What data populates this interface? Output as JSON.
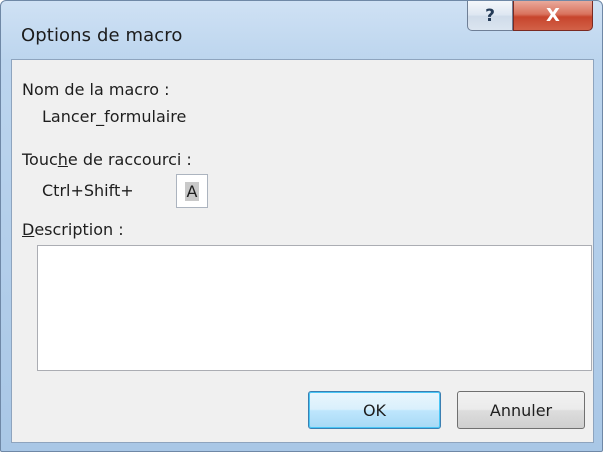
{
  "window": {
    "title": "Options de macro",
    "help_glyph": "?",
    "close_glyph": "X"
  },
  "macro": {
    "name_label": "Nom de la macro :",
    "name_value": "Lancer_formulaire"
  },
  "shortcut": {
    "label_before": "Touc",
    "label_mnemonic": "h",
    "label_after": "e de raccourci :",
    "prefix": "Ctrl+Shift+",
    "key_value": "A"
  },
  "description": {
    "label_mnemonic": "D",
    "label_rest": "escription :",
    "value": ""
  },
  "buttons": {
    "ok": "OK",
    "cancel": "Annuler"
  },
  "colors": {
    "frame": "#bcd5ee",
    "client": "#f0f0f0",
    "close_button": "#c7452c",
    "default_button_border": "#3c7fb1"
  },
  "icons": {
    "help": "help-icon",
    "close": "close-icon"
  }
}
